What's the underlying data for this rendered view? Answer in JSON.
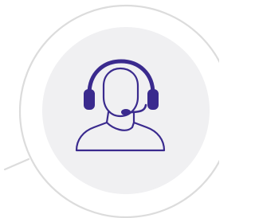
{
  "colors": {
    "background": "#ffffff",
    "outer_ring": "#dcdcdc",
    "inner_circle": "#f0f0f2",
    "icon_stroke": "#3a2a8e",
    "icon_fill": "#3a2a8e"
  },
  "icon": {
    "name": "customer-support-headset-icon"
  }
}
